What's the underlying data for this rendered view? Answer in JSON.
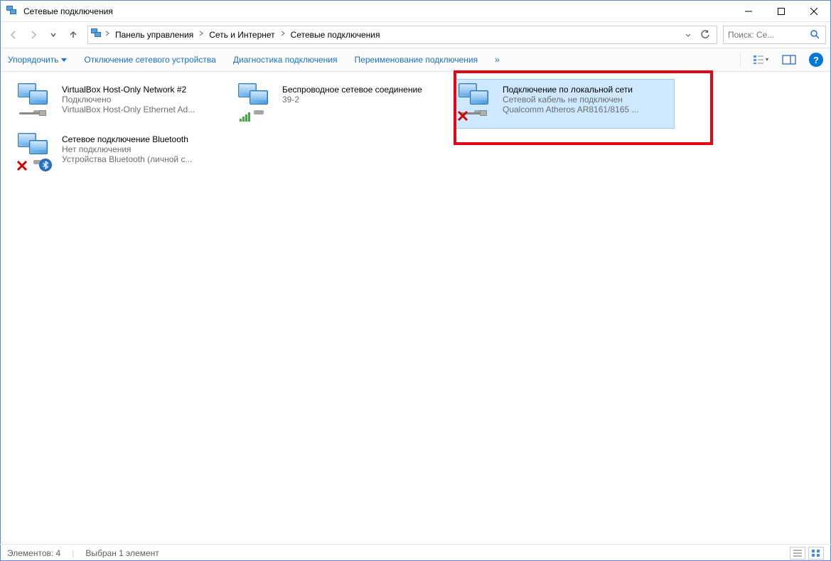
{
  "window": {
    "title": "Сетевые подключения"
  },
  "breadcrumb": {
    "items": [
      "Панель управления",
      "Сеть и Интернет",
      "Сетевые подключения"
    ]
  },
  "search": {
    "placeholder": "Поиск: Се..."
  },
  "toolbar": {
    "organize": "Упорядочить",
    "disable": "Отключение сетевого устройства",
    "diagnose": "Диагностика подключения",
    "rename": "Переименование подключения",
    "overflow": "»"
  },
  "connections": [
    {
      "name": "VirtualBox Host-Only Network #2",
      "status": "Подключено",
      "device": "VirtualBox Host-Only Ethernet Ad...",
      "icon": "ethernet",
      "badge": "none"
    },
    {
      "name": "Беспроводное сетевое соединение",
      "status": "39-2",
      "device": "",
      "icon": "wireless",
      "badge": "bars"
    },
    {
      "name": "Подключение по локальной сети",
      "status": "Сетевой кабель не подключен",
      "device": "Qualcomm Atheros AR8161/8165 ...",
      "icon": "ethernet",
      "badge": "x",
      "selected": true
    },
    {
      "name": "Сетевое подключение Bluetooth",
      "status": "Нет подключения",
      "device": "Устройства Bluetooth (личной с...",
      "icon": "bluetooth",
      "badge": "x-bt"
    }
  ],
  "status": {
    "count_label": "Элементов: 4",
    "selection_label": "Выбран 1 элемент"
  }
}
